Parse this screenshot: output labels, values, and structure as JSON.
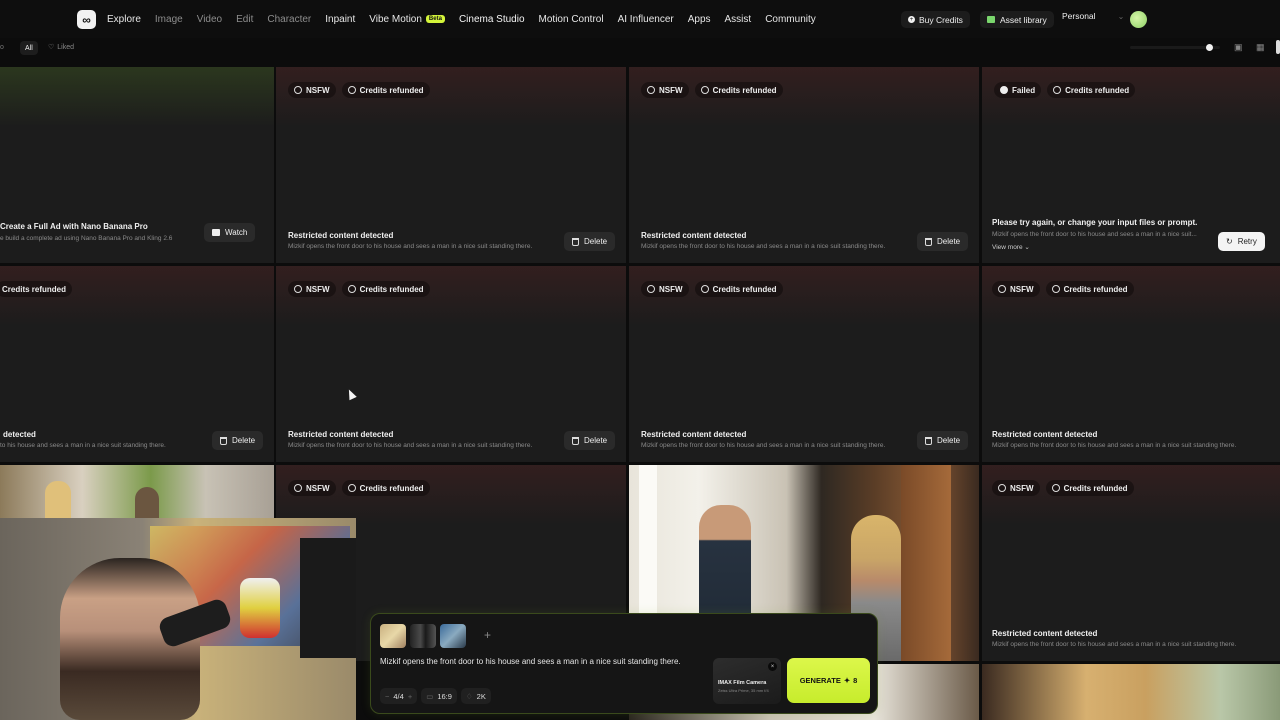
{
  "nav": {
    "items": [
      {
        "label": "Explore",
        "state": "bright"
      },
      {
        "label": "Image",
        "state": "dim"
      },
      {
        "label": "Video",
        "state": "dim"
      },
      {
        "label": "Edit",
        "state": "dim"
      },
      {
        "label": "Character",
        "state": "dim"
      },
      {
        "label": "Inpaint",
        "state": "bright"
      },
      {
        "label": "Vibe Motion",
        "state": "bright"
      },
      {
        "label": "Cinema Studio",
        "state": "active"
      },
      {
        "label": "Motion Control",
        "state": "bright"
      },
      {
        "label": "AI Influencer",
        "state": "bright"
      },
      {
        "label": "Apps",
        "state": "bright"
      },
      {
        "label": "Assist",
        "state": "bright"
      },
      {
        "label": "Community",
        "state": "bright"
      }
    ],
    "beta_label": "Beta",
    "buy_credits": "Buy Credits",
    "asset_library": "Asset library",
    "workspace": "Personal"
  },
  "filters": {
    "all": "All",
    "liked": "Liked"
  },
  "tiles": {
    "promo_title": "Create a Full Ad with Nano Banana Pro",
    "promo_sub": "e build a complete ad using Nano Banana Pro and Kling 2.6",
    "watch": "Watch",
    "nsfw": "NSFW",
    "failed": "Failed",
    "credits_refunded": "Credits refunded",
    "restricted": "Restricted content detected",
    "restricted_partial": "detected",
    "prompt": "Mizkif opens the front door to his house and sees a man in a nice suit standing there.",
    "prompt_partial": "to his house and sees a man in a nice suit standing there.",
    "prompt_cut": "Mizkif opens the front door to his house and sees a man in a nice suit...",
    "try_again": "Please try again, or change your input files or prompt.",
    "view_more": "View more",
    "delete": "Delete",
    "retry": "Retry"
  },
  "panel": {
    "prompt": "Mizkif opens the front door to his house and sees a man in a nice suit standing there.",
    "count": "4/4",
    "ratio": "16:9",
    "resolution": "2K",
    "camera_name": "IMAX Film Camera",
    "camera_sub": "Zeiss Ultra Prime, 35 mm f/4",
    "generate": "GENERATE",
    "generate_cost": "8"
  },
  "colors": {
    "accent": "#d4f53a",
    "tile_bg": "#1c1c1c",
    "page_bg": "#0c0c0c"
  }
}
